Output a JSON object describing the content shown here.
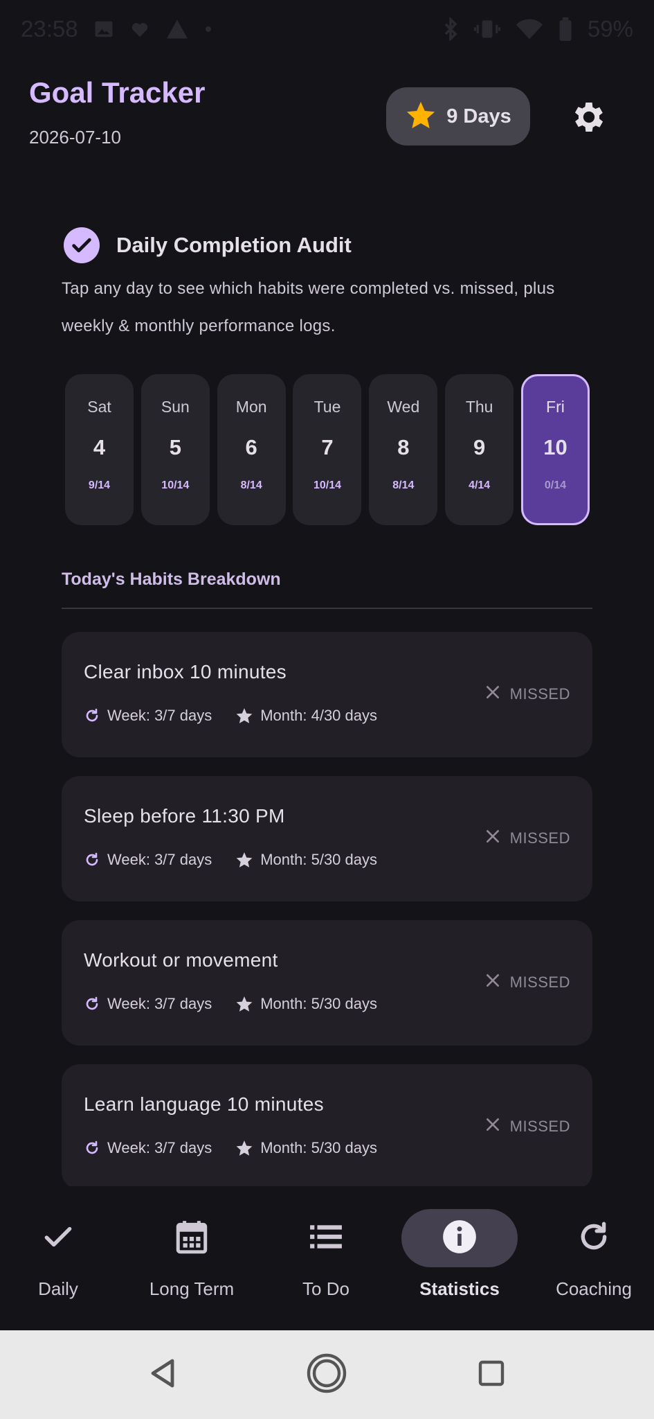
{
  "status_bar": {
    "time": "23:58",
    "battery": "59%"
  },
  "header": {
    "title": "Goal Tracker",
    "date": "2026-07-10",
    "streak_label": "9 Days"
  },
  "audit": {
    "title": "Daily Completion Audit",
    "description": "Tap any day to see which habits were completed vs. missed, plus weekly & monthly performance logs."
  },
  "days": [
    {
      "name": "Sat",
      "num": "4",
      "count": "9/14",
      "selected": false
    },
    {
      "name": "Sun",
      "num": "5",
      "count": "10/14",
      "selected": false
    },
    {
      "name": "Mon",
      "num": "6",
      "count": "8/14",
      "selected": false
    },
    {
      "name": "Tue",
      "num": "7",
      "count": "10/14",
      "selected": false
    },
    {
      "name": "Wed",
      "num": "8",
      "count": "8/14",
      "selected": false
    },
    {
      "name": "Thu",
      "num": "9",
      "count": "4/14",
      "selected": false
    },
    {
      "name": "Fri",
      "num": "10",
      "count": "0/14",
      "selected": true
    }
  ],
  "breakdown": {
    "title": "Today's Habits Breakdown",
    "habits": [
      {
        "name": "Clear inbox 10 minutes",
        "week": "Week: 3/7 days",
        "month": "Month: 4/30 days",
        "status": "MISSED"
      },
      {
        "name": "Sleep before 11:30 PM",
        "week": "Week: 3/7 days",
        "month": "Month: 5/30 days",
        "status": "MISSED"
      },
      {
        "name": "Workout or movement",
        "week": "Week: 3/7 days",
        "month": "Month: 5/30 days",
        "status": "MISSED"
      },
      {
        "name": "Learn language 10 minutes",
        "week": "Week: 3/7 days",
        "month": "Month: 5/30 days",
        "status": "MISSED"
      }
    ]
  },
  "nav": {
    "items": [
      {
        "label": "Daily",
        "icon": "check-icon"
      },
      {
        "label": "Long Term",
        "icon": "calendar-icon"
      },
      {
        "label": "To Do",
        "icon": "list-icon"
      },
      {
        "label": "Statistics",
        "icon": "info-icon"
      },
      {
        "label": "Coaching",
        "icon": "refresh-icon"
      }
    ],
    "active": "Statistics"
  },
  "colors": {
    "accent": "#d6baff",
    "background": "#141318",
    "card": "#221f27",
    "selected_day": "#5a3c9a",
    "star": "#ffb300"
  }
}
